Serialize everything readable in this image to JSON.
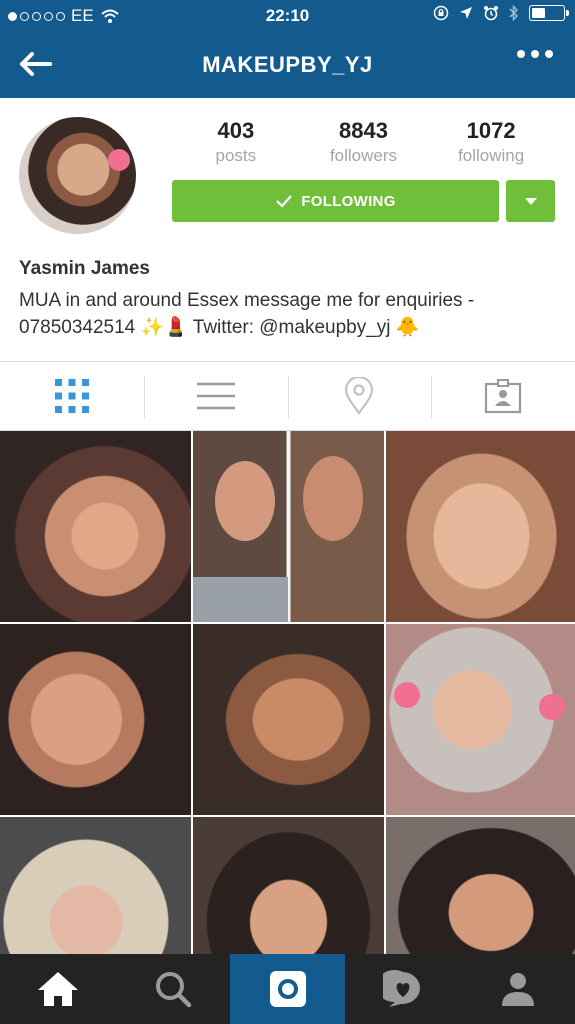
{
  "status_bar": {
    "carrier": "EE",
    "time": "22:10",
    "battery_level": 0.45
  },
  "header": {
    "title": "MAKEUPBY_YJ",
    "back_icon": "arrow-left-icon",
    "more_icon": "more-dots-icon"
  },
  "profile": {
    "stats": [
      {
        "value": "403",
        "label": "posts"
      },
      {
        "value": "8843",
        "label": "followers"
      },
      {
        "value": "1072",
        "label": "following"
      }
    ],
    "follow_button": "FOLLOWING",
    "name": "Yasmin James",
    "bio": "MUA in and around Essex message me for enquiries - 07850342514 ✨💄 Twitter: @makeupby_yj 🐥"
  },
  "tabs": [
    "grid-view-icon",
    "list-view-icon",
    "location-icon",
    "tagged-photos-icon"
  ],
  "grid_photo_count": 9,
  "bottom_nav": [
    "home-icon",
    "search-icon",
    "camera-icon",
    "activity-icon",
    "profile-icon"
  ],
  "colors": {
    "header_bg": "#135a8e",
    "follow_green": "#6fbf3a",
    "bottom_bar": "#232323",
    "active_tab": "#135a8e"
  }
}
